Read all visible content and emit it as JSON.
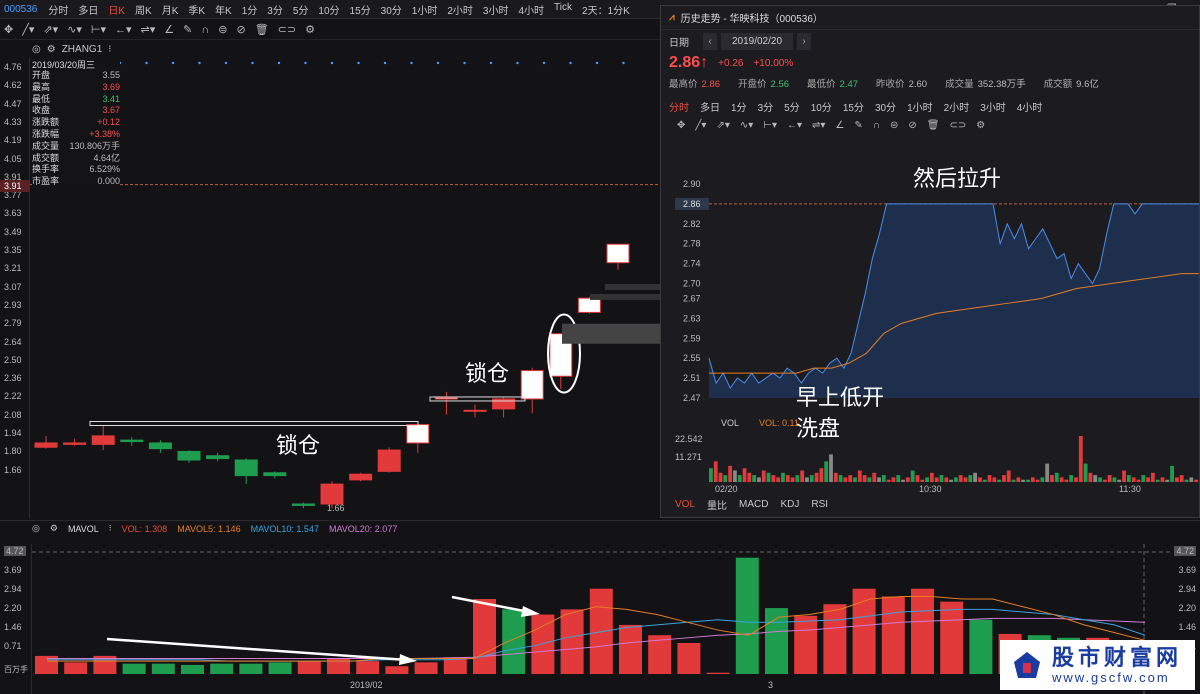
{
  "topbar": {
    "code": "000536",
    "timeframes": [
      "分时",
      "多日",
      "日K",
      "周K",
      "月K",
      "季K",
      "年K",
      "1分",
      "3分",
      "5分",
      "10分",
      "15分",
      "30分",
      "1小时",
      "2小时",
      "3小时",
      "4小时",
      "Tick",
      "2天：1分K"
    ],
    "active": "日K"
  },
  "chart": {
    "indicator_name": "ZHANG1",
    "y_ticks": [
      "4.76",
      "4.62",
      "4.47",
      "4.33",
      "4.19",
      "4.05",
      "3.91",
      "3.77",
      "3.63",
      "3.49",
      "3.35",
      "3.21",
      "3.07",
      "2.93",
      "2.79",
      "2.64",
      "2.50",
      "2.36",
      "2.22",
      "2.08",
      "1.94",
      "1.80",
      "1.66"
    ],
    "price_highlight": "3.91",
    "low_label": "1.66"
  },
  "infobox": {
    "date": "2019/03/20周三",
    "rows": [
      {
        "label": "开盘",
        "value": "3.55",
        "color": "#bbbbbb"
      },
      {
        "label": "最高",
        "value": "3.69",
        "color": "#ff4d4d"
      },
      {
        "label": "最低",
        "value": "3.41",
        "color": "#3fc16b"
      },
      {
        "label": "收盘",
        "value": "3.67",
        "color": "#ff4d4d"
      },
      {
        "label": "涨跌额",
        "value": "+0.12",
        "color": "#ff4d4d"
      },
      {
        "label": "涨跌幅",
        "value": "+3.38%",
        "color": "#ff4d4d"
      },
      {
        "label": "成交量",
        "value": "130.806万手",
        "color": "#bbbbbb"
      },
      {
        "label": "成交额",
        "value": "4.64亿",
        "color": "#bbbbbb"
      },
      {
        "label": "换手率",
        "value": "6.529%",
        "color": "#bbbbbb"
      },
      {
        "label": "市盈率",
        "value": "0.000",
        "color": "#bbbbbb"
      }
    ]
  },
  "annotations": {
    "lock1": "锁仓",
    "lock2": "锁仓",
    "rise": "然后拉升",
    "low_open_1": "早上低开",
    "low_open_2": "洗盘"
  },
  "popup": {
    "title": "历史走势 - 华映科技（000536）",
    "date_label": "日期",
    "date": "2019/02/20",
    "price": "2.86",
    "arrow": "↑",
    "change": "+0.26",
    "change_pct": "+10.00%",
    "stats": [
      {
        "label": "最高价",
        "value": "2.86",
        "color": "#ff4d4d"
      },
      {
        "label": "开盘价",
        "value": "2.56",
        "color": "#3fc16b"
      },
      {
        "label": "最低价",
        "value": "2.47",
        "color": "#3fc16b"
      },
      {
        "label": "昨收价",
        "value": "2.60",
        "color": "#bbbbbb"
      },
      {
        "label": "成交量",
        "value": "352.38万手",
        "color": "#bbbbbb"
      },
      {
        "label": "成交额",
        "value": "9.6亿",
        "color": "#bbbbbb"
      }
    ],
    "timeframes": [
      "分时",
      "多日",
      "1分",
      "3分",
      "5分",
      "10分",
      "15分",
      "30分",
      "1小时",
      "2小时",
      "3小时",
      "4小时"
    ],
    "active": "分时",
    "y_ticks": [
      "2.90",
      "2.86",
      "2.82",
      "2.78",
      "2.74",
      "2.70",
      "2.67",
      "2.63",
      "2.59",
      "2.55",
      "2.51",
      "2.47"
    ],
    "vol_label": "VOL",
    "vol_value": "VOL: 0.11",
    "vol_ticks": [
      "22.542",
      "11.271"
    ],
    "x_ticks": [
      "02/20",
      "10:30",
      "11:30"
    ],
    "footer_tabs": [
      "VOL",
      "量比",
      "MACD",
      "KDJ",
      "RSI"
    ]
  },
  "vol_panel": {
    "name": "MAVOL",
    "vol": "VOL: 1.308",
    "ma5": "MAVOL5: 1.146",
    "ma10": "MAVOL10: 1.547",
    "ma20": "MAVOL20: 2.077",
    "y_ticks": [
      "4.72",
      "3.69",
      "2.94",
      "2.20",
      "1.46",
      "0.71"
    ],
    "unit": "百万手",
    "x_labels": [
      "2019/02",
      "3"
    ],
    "colors": {
      "ma5": "#e67e22",
      "ma10": "#3ba3e0",
      "ma20": "#d17ad6",
      "up": "#e23a3a",
      "down": "#1f9d4f"
    }
  },
  "watermark": {
    "line1": "股市财富网",
    "line2": "www.gscfw.com"
  }
}
